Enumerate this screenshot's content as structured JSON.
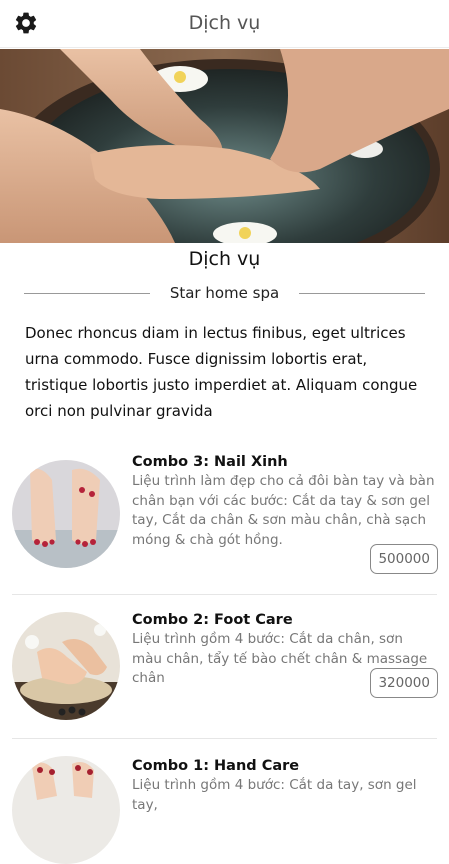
{
  "header": {
    "title": "Dịch vụ",
    "settings_icon": "gear-icon"
  },
  "hero": {
    "image": "spa-foot-bath-photo"
  },
  "section": {
    "title": "Dịch vụ",
    "subtitle": "Star home spa",
    "intro": "Donec rhoncus diam in lectus finibus, eget ultrices urna commodo. Fusce dignissim lobortis erat, tristique lobortis justo imperdiet at. Aliquam congue orci non pulvinar gravida"
  },
  "services": [
    {
      "title": "Combo 3: Nail Xinh",
      "description": "Liệu trình làm đẹp cho cả đôi bàn tay và bàn chân bạn với các bước: Cắt da tay & sơn gel tay, Cắt da chân & sơn màu chân, chà sạch móng & chà gót hồng.",
      "price": "500000",
      "image": "nail-feet-photo"
    },
    {
      "title": "Combo 2: Foot Care",
      "description": "Liệu trình gồm 4 bước: Cắt da chân, sơn màu chân, tẩy tế bào chết chân & massage chân",
      "price": "320000",
      "image": "foot-care-photo"
    },
    {
      "title": "Combo 1: Hand Care",
      "description": "Liệu trình gồm 4 bước: Cắt da tay, sơn gel tay,",
      "price": "",
      "image": "hand-care-photo"
    }
  ]
}
